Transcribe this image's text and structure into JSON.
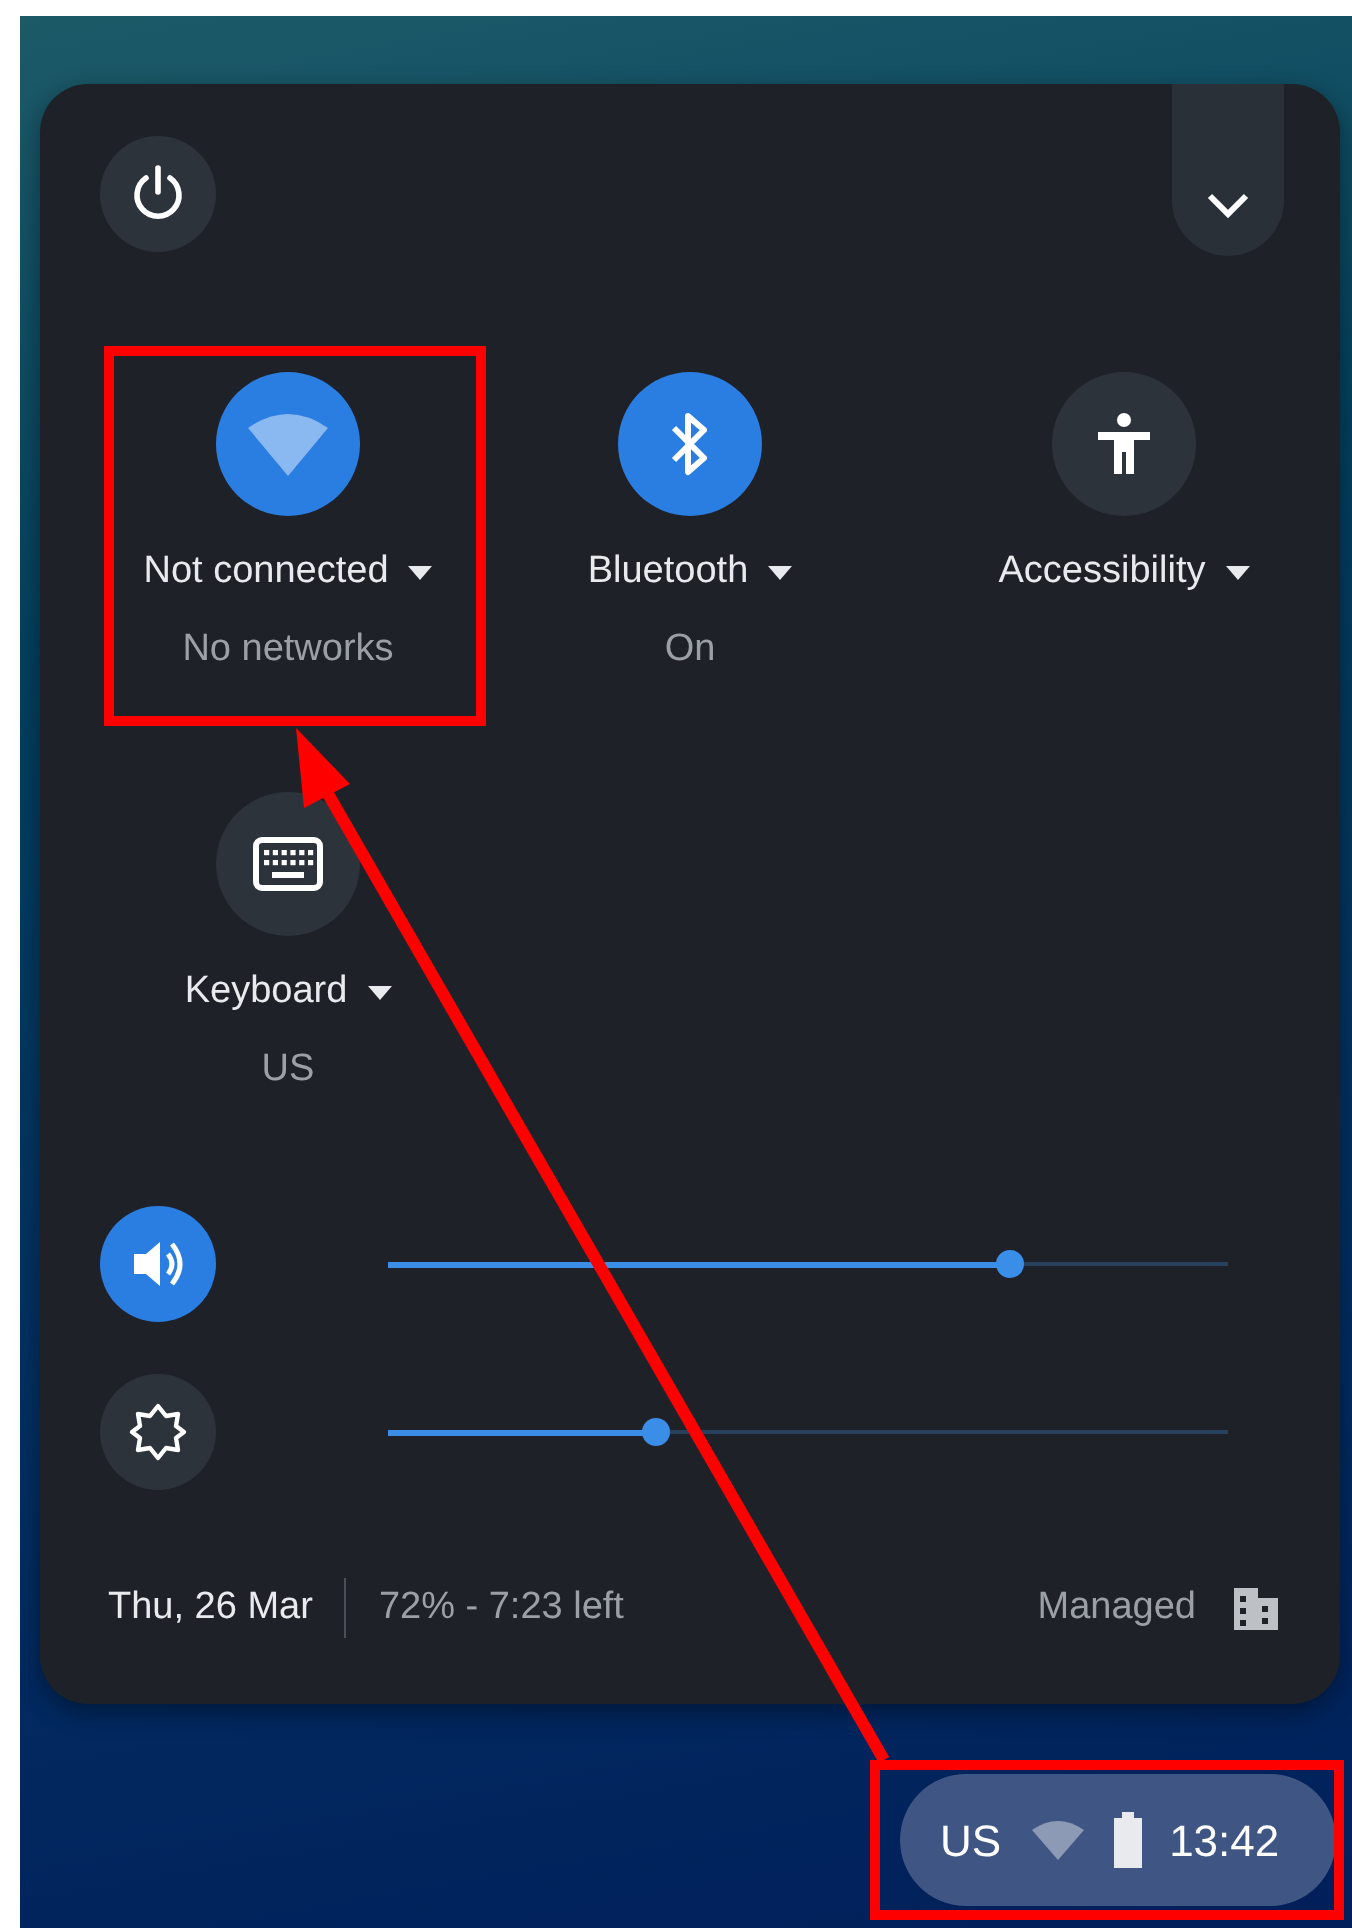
{
  "tiles": [
    {
      "kind": "network",
      "label": "Not connected",
      "sublabel": "No networks",
      "on": true
    },
    {
      "kind": "bluetooth",
      "label": "Bluetooth",
      "sublabel": "On",
      "on": true
    },
    {
      "kind": "accessibility",
      "label": "Accessibility",
      "on": false
    },
    {
      "kind": "keyboard",
      "label": "Keyboard",
      "sublabel": "US",
      "on": false
    }
  ],
  "sliders": [
    {
      "kind": "volume",
      "on": true,
      "level": 0.74
    },
    {
      "kind": "brightness",
      "on": false,
      "level": 0.32
    }
  ],
  "footer": {
    "date": "Thu, 26 Mar",
    "battery": "72% - 7:23 left",
    "managed": "Managed"
  },
  "shelf": {
    "ime": "US",
    "time": "13:42"
  }
}
